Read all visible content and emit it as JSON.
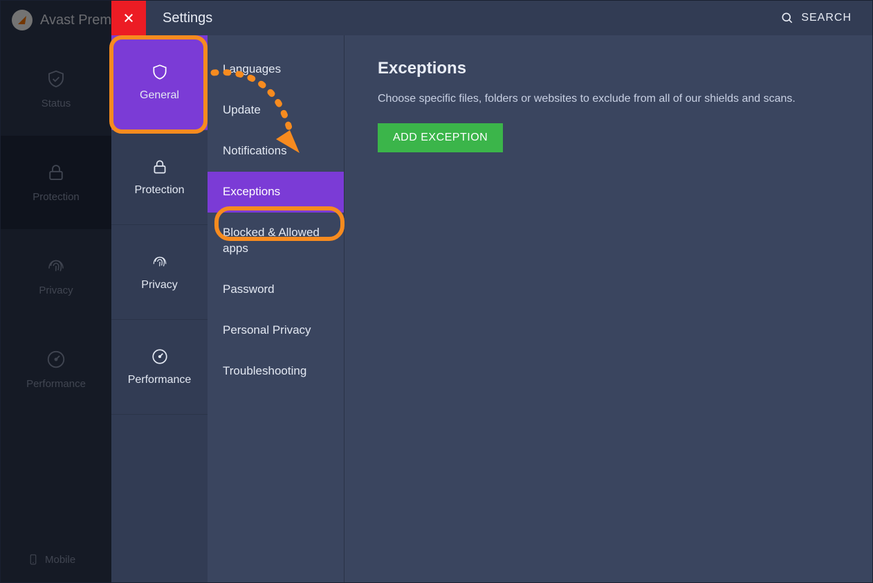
{
  "brand": {
    "name": "Avast Premi"
  },
  "main_nav": {
    "items": [
      {
        "label": "Status"
      },
      {
        "label": "Protection"
      },
      {
        "label": "Privacy"
      },
      {
        "label": "Performance"
      }
    ],
    "mobile": "Mobile"
  },
  "settings": {
    "title": "Settings",
    "search": "SEARCH",
    "categories": [
      {
        "label": "General"
      },
      {
        "label": "Protection"
      },
      {
        "label": "Privacy"
      },
      {
        "label": "Performance"
      }
    ],
    "submenu": [
      "Languages",
      "Update",
      "Notifications",
      "Exceptions",
      "Blocked & Allowed apps",
      "Password",
      "Personal Privacy",
      "Troubleshooting"
    ]
  },
  "content": {
    "heading": "Exceptions",
    "description": "Choose specific files, folders or websites to exclude from all of our shields and scans.",
    "add_button": "ADD EXCEPTION"
  }
}
